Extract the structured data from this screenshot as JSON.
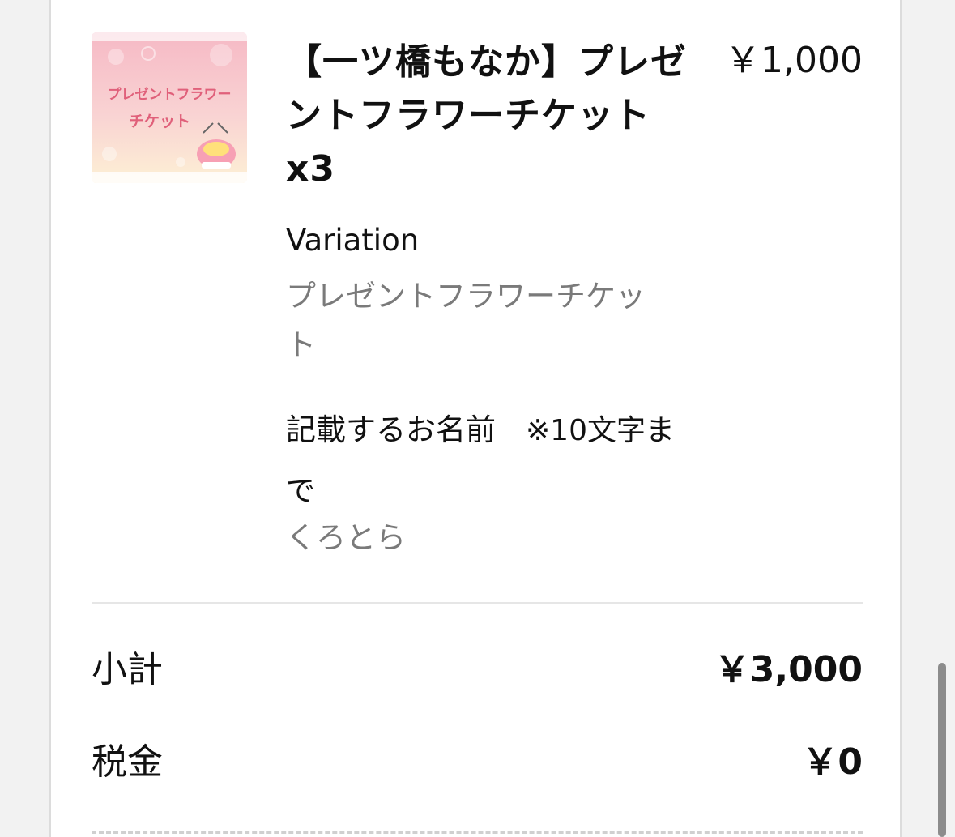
{
  "item": {
    "thumbnail_text_line1": "プレゼントフラワー",
    "thumbnail_text_line2": "チケット",
    "title": "【一ツ橋もなか】プレゼントフラワーチケット x3",
    "price": "￥1,000",
    "variation_label": "Variation",
    "variation_value": "プレゼントフラワーチケット",
    "name_label": "記載するお名前　",
    "name_note": "※10文字まで",
    "name_value": "くろとら"
  },
  "summary": {
    "subtotal_label": "小計",
    "subtotal_value": "￥3,000",
    "tax_label": "税金",
    "tax_value": "￥0"
  },
  "colors": {
    "muted_text": "#7a7a7a",
    "thumb_pink": "#f5b8c4",
    "thumb_cream": "#fdf2d8",
    "thumb_text": "#e0607a"
  }
}
